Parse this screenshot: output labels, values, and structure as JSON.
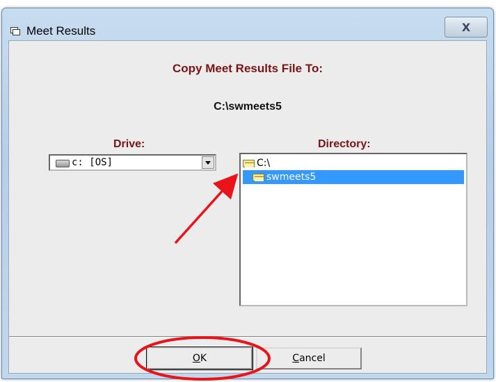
{
  "window": {
    "title": "Meet Results",
    "close_label": "X"
  },
  "dialog": {
    "heading": "Copy Meet Results File To:",
    "target_path": "C:\\swmeets5",
    "drive_label": "Drive:",
    "directory_label": "Directory:"
  },
  "drive_combo": {
    "selected": "c: [OS]"
  },
  "directory_list": {
    "items": [
      {
        "label": "C:\\",
        "icon": "open-folder-icon",
        "selected": false
      },
      {
        "label": "swmeets5",
        "icon": "open-folder-icon",
        "selected": true
      }
    ]
  },
  "buttons": {
    "ok_u": "O",
    "ok_rest": "K",
    "cancel_u": "C",
    "cancel_rest": "ancel"
  },
  "colors": {
    "accent_label": "#7a1414",
    "selection": "#3399ff",
    "annotation": "#e8141a"
  }
}
